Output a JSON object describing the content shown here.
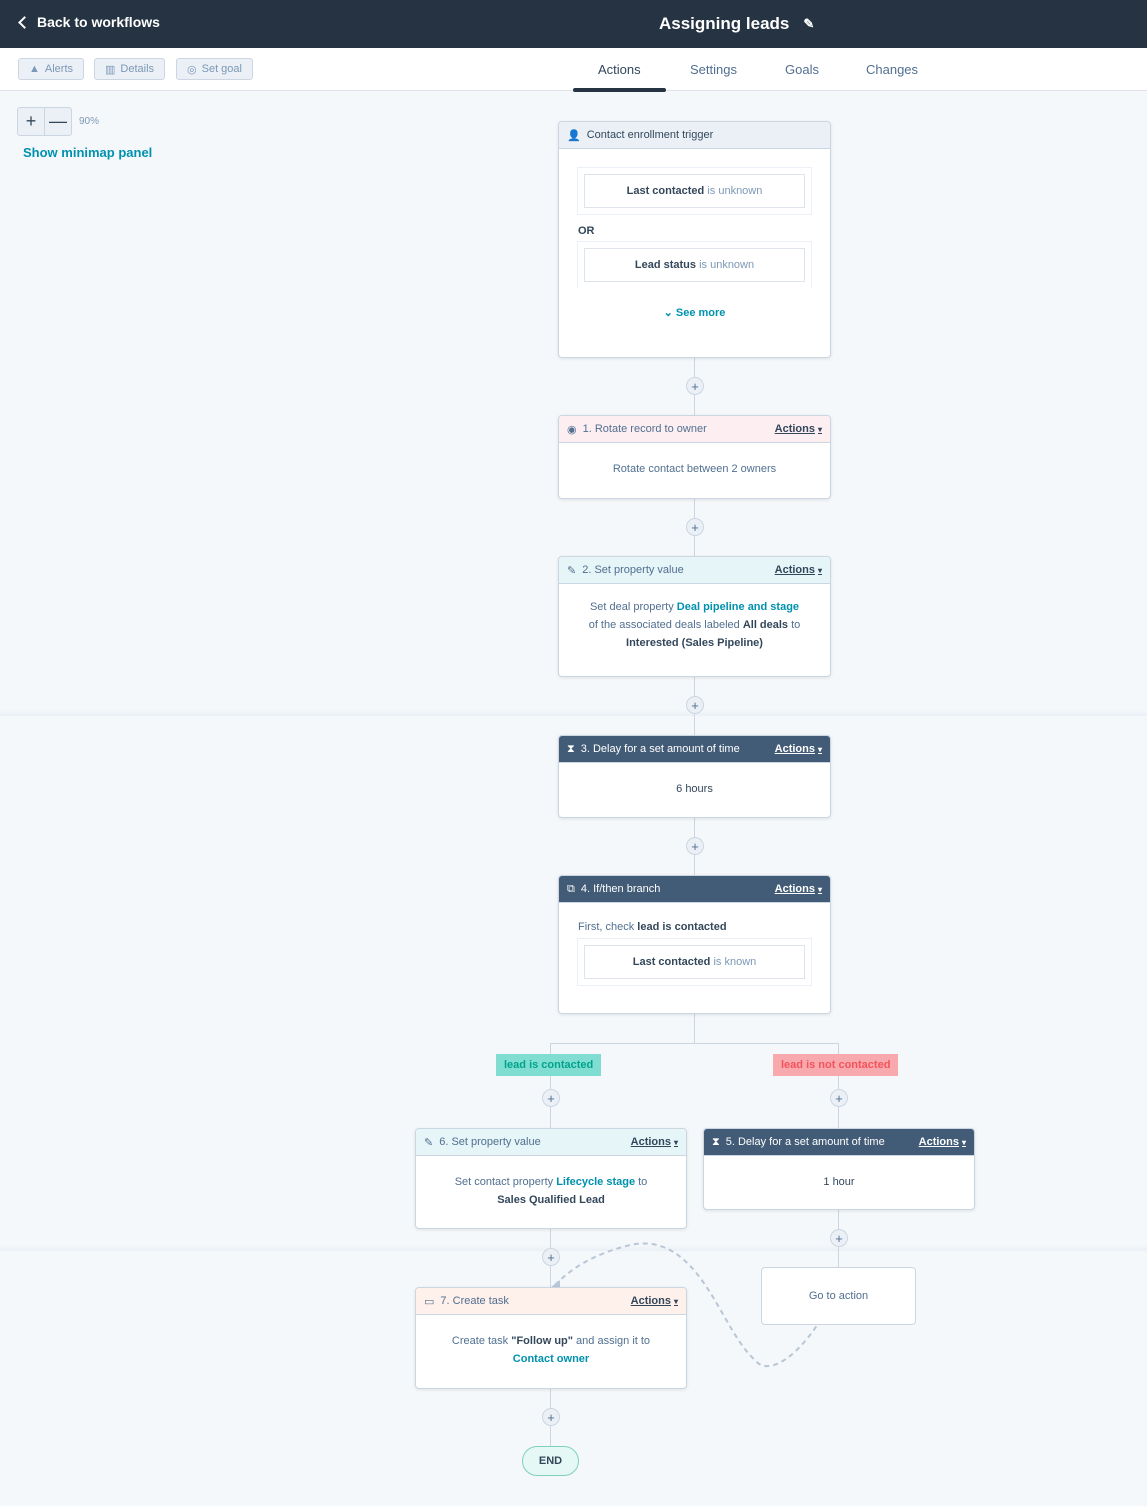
{
  "header": {
    "back_label": "Back to workflows",
    "title": "Assigning leads",
    "edit_icon": "pencil-icon"
  },
  "toolbar": {
    "alerts": "Alerts",
    "details": "Details",
    "set_goal": "Set goal"
  },
  "tabs": [
    {
      "label": "Actions",
      "active": true
    },
    {
      "label": "Settings",
      "active": false
    },
    {
      "label": "Goals",
      "active": false
    },
    {
      "label": "Changes",
      "active": false
    }
  ],
  "zoom": {
    "plus": "+",
    "minus": "—",
    "level": "90%",
    "minimap": "Show minimap panel"
  },
  "trigger": {
    "title": "Contact enrollment trigger",
    "filters": [
      {
        "property": "Last contacted",
        "condition": "is unknown"
      },
      {
        "property": "Lead status",
        "condition": "is unknown"
      }
    ],
    "or_label": "OR",
    "see_more": "See more"
  },
  "actions_label": "Actions",
  "step1": {
    "title": "1. Rotate record to owner",
    "body": "Rotate contact between 2 owners"
  },
  "step2": {
    "title": "2. Set property value",
    "pre": "Set deal property ",
    "prop": "Deal pipeline and stage",
    "mid": "of the associated deals labeled ",
    "label": "All deals",
    "to": " to",
    "value": "Interested (Sales Pipeline)"
  },
  "step3": {
    "title": "3. Delay for a set amount of time",
    "body": "6 hours"
  },
  "step4": {
    "title": "4. If/then branch",
    "check_pre": "First, check ",
    "check_name": "lead is contacted",
    "filter_property": "Last contacted",
    "filter_condition": "is known"
  },
  "branches": {
    "yes": "lead is contacted",
    "no": "lead is not contacted",
    "yes_color": "#7fded1",
    "no_color": "#f8a9ad"
  },
  "step6": {
    "title": "6. Set property value",
    "pre": "Set contact property ",
    "prop": "Lifecycle stage",
    "to": " to",
    "value": "Sales Qualified Lead"
  },
  "step5": {
    "title": "5. Delay for a set amount of time",
    "body": "1 hour"
  },
  "step7": {
    "title": "7. Create task",
    "pre": "Create task ",
    "task": "\"Follow up\"",
    "mid": " and assign it to",
    "owner": "Contact owner"
  },
  "goto": "Go to action",
  "end": "END",
  "plus": "+"
}
